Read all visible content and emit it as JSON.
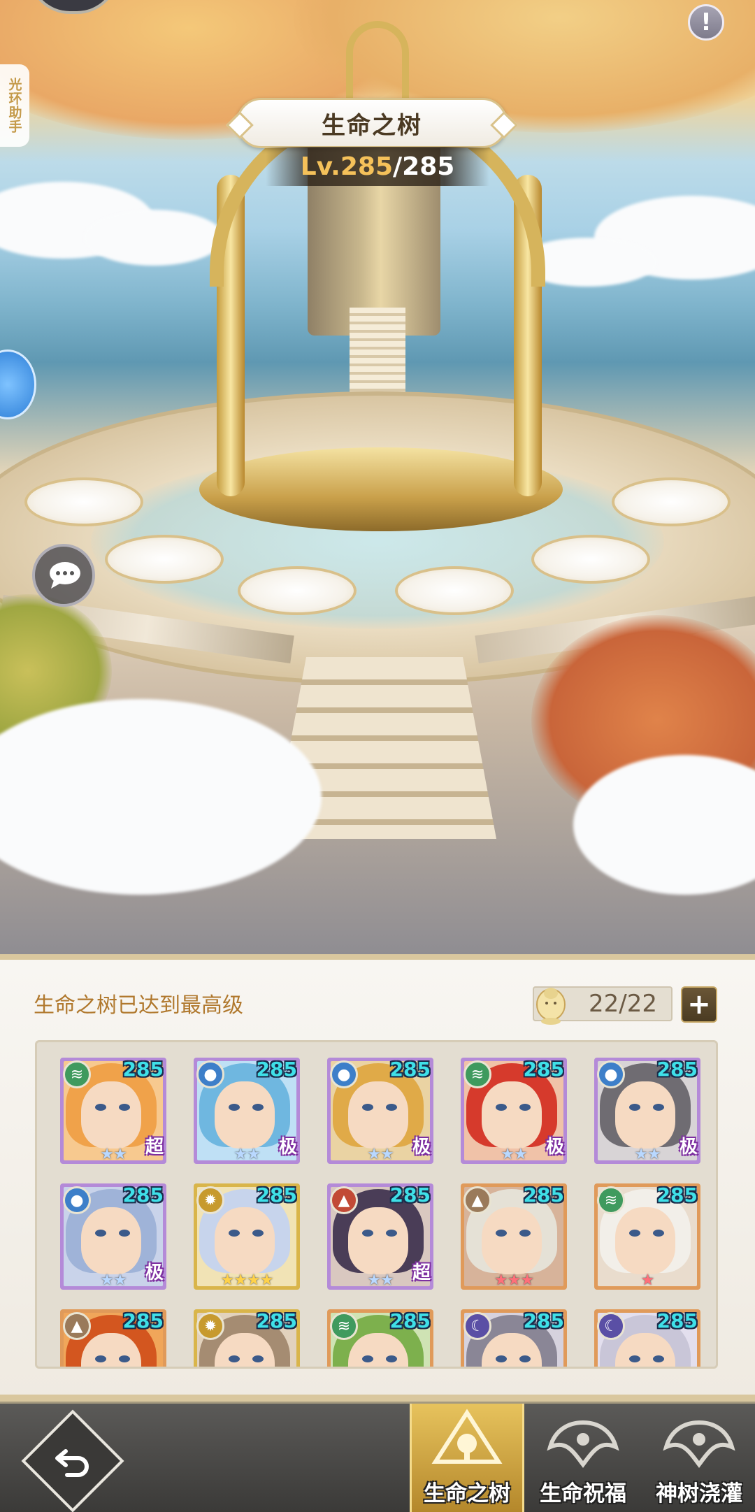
{
  "header": {
    "title": "生命之树",
    "level_prefix": "Lv.",
    "level_current": "285",
    "level_sep": "/",
    "level_max": "285",
    "assistant_label": "光环助手",
    "info_label": "!"
  },
  "panel": {
    "status_text": "生命之树已达到最高级",
    "slots_text": "22/22",
    "add_label": "+"
  },
  "heroes": [
    {
      "level": "285",
      "tag": "超",
      "stars": "★★",
      "star_color": "#b9d8ff",
      "element": "wind",
      "frame": "purple",
      "hair": "#f0a24a",
      "bg": "#f7c98f"
    },
    {
      "level": "285",
      "tag": "极",
      "stars": "★★",
      "star_color": "#b9d8ff",
      "element": "water",
      "frame": "purple",
      "hair": "#6fb7e0",
      "bg": "#bfe0f5"
    },
    {
      "level": "285",
      "tag": "极",
      "stars": "★★",
      "star_color": "#b9d8ff",
      "element": "water",
      "frame": "purple",
      "hair": "#e0aa48",
      "bg": "#ead3a3"
    },
    {
      "level": "285",
      "tag": "极",
      "stars": "★★",
      "star_color": "#b9d8ff",
      "element": "wind",
      "frame": "purple",
      "hair": "#d63a2c",
      "bg": "#f0c2a8"
    },
    {
      "level": "285",
      "tag": "极",
      "stars": "★★",
      "star_color": "#b9d8ff",
      "element": "water",
      "frame": "purple",
      "hair": "#6f6c72",
      "bg": "#d8d4d6"
    },
    {
      "level": "285",
      "tag": "极",
      "stars": "★★",
      "star_color": "#b9d8ff",
      "element": "water",
      "frame": "purple",
      "hair": "#9fb3d8",
      "bg": "#c9d3ea"
    },
    {
      "level": "285",
      "tag": "",
      "stars": "★★★★",
      "star_color": "#ffd24a",
      "element": "light",
      "frame": "gold",
      "hair": "#c7d4ec",
      "bg": "#f1e3b5"
    },
    {
      "level": "285",
      "tag": "超",
      "stars": "★★",
      "star_color": "#b9d8ff",
      "element": "fire",
      "frame": "purple",
      "hair": "#4a3d57",
      "bg": "#d9c8c0"
    },
    {
      "level": "285",
      "tag": "",
      "stars": "★★★",
      "star_color": "#ff6f7a",
      "element": "earth",
      "frame": "orange",
      "hair": "#e5e1d6",
      "bg": "#d7b39a"
    },
    {
      "level": "285",
      "tag": "",
      "stars": "★",
      "star_color": "#ff6f7a",
      "element": "wind",
      "frame": "orange",
      "hair": "#f2efe9",
      "bg": "#e9dccd"
    },
    {
      "level": "285",
      "tag": "",
      "stars": "",
      "star_color": "#ffd24a",
      "element": "earth",
      "frame": "orange",
      "hair": "#d3561f",
      "bg": "#f0a65a"
    },
    {
      "level": "285",
      "tag": "",
      "stars": "",
      "star_color": "#ffd24a",
      "element": "light",
      "frame": "gold",
      "hair": "#a58c72",
      "bg": "#e2d2bd"
    },
    {
      "level": "285",
      "tag": "",
      "stars": "",
      "star_color": "#ffd24a",
      "element": "wind",
      "frame": "orange",
      "hair": "#7db04d",
      "bg": "#cfe3b4"
    },
    {
      "level": "285",
      "tag": "",
      "stars": "",
      "star_color": "#ffd24a",
      "element": "dark",
      "frame": "orange",
      "hair": "#8a8696",
      "bg": "#d6d2de"
    },
    {
      "level": "285",
      "tag": "",
      "stars": "",
      "star_color": "#ffd24a",
      "element": "dark",
      "frame": "orange",
      "hair": "#c9c6d8",
      "bg": "#e3dfee"
    }
  ],
  "element_colors": {
    "wind": "#3f9a5e",
    "water": "#3d7fc9",
    "light": "#c79a2e",
    "fire": "#c24a36",
    "earth": "#9a7a5a",
    "dark": "#5a4fa5"
  },
  "frame_colors": {
    "purple": "#b48ad8",
    "gold": "#d9b54a",
    "orange": "#e09a5a"
  },
  "element_icons": {
    "wind": "wind-icon",
    "water": "water-drop-icon",
    "light": "sun-icon",
    "fire": "flame-icon",
    "earth": "mountain-icon",
    "dark": "moon-icon"
  },
  "nav": {
    "tabs": [
      {
        "label": "生命之树",
        "active": true
      },
      {
        "label": "生命祝福",
        "active": false
      },
      {
        "label": "神树浇灌",
        "active": false
      }
    ]
  }
}
